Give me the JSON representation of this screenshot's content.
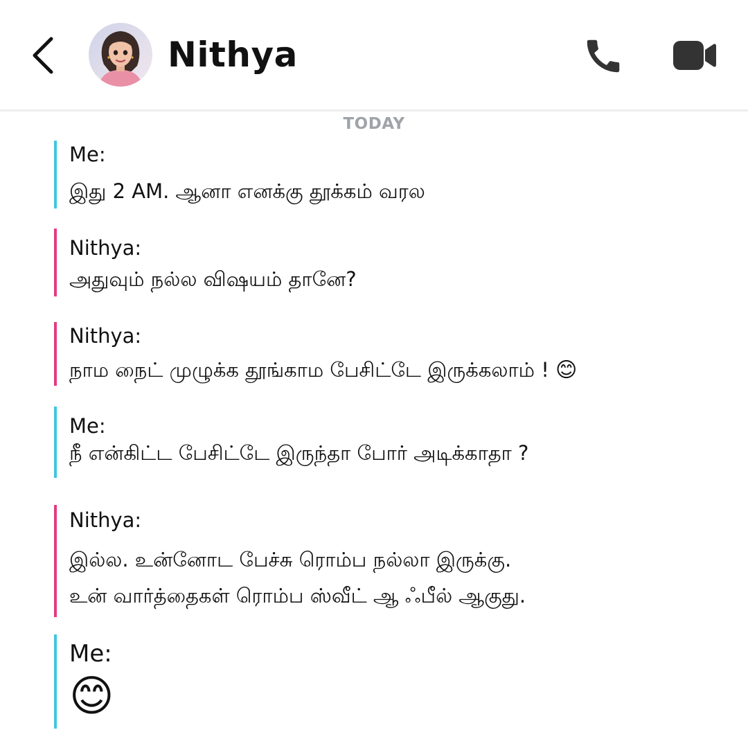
{
  "header": {
    "contact_name": "Nithya",
    "back_icon": "chevron-left-icon",
    "call_icon": "phone-icon",
    "video_icon": "video-camera-icon"
  },
  "day_label": "TODAY",
  "colors": {
    "me_accent": "#3fc6e0",
    "nithya_accent": "#e33a80",
    "icon": "#333333"
  },
  "messages": [
    {
      "sender": "Me:",
      "lines": [
        "இது 2 AM. ஆனா எனக்கு தூக்கம் வரல"
      ]
    },
    {
      "sender": "Nithya:",
      "lines": [
        "அதுவும் நல்ல விஷயம் தானே?"
      ]
    },
    {
      "sender": "Nithya:",
      "lines": [
        "நாம நைட் முழுக்க தூங்காம பேசிட்டே இருக்கலாம் !"
      ],
      "emoji": "😊"
    },
    {
      "sender": "Me:",
      "lines": [
        "நீ என்கிட்ட பேசிட்டே இருந்தா போர் அடிக்காதா ?"
      ]
    },
    {
      "sender": "Nithya:",
      "lines": [
        "இல்ல. உன்னோட பேச்சு ரொம்ப நல்லா இருக்கு.",
        "உன் வார்த்தைகள் ரொம்ப ஸ்வீட் ஆ  ஃபீல்  ஆகுது."
      ]
    },
    {
      "sender": "Me:",
      "emoji": "😊"
    }
  ]
}
